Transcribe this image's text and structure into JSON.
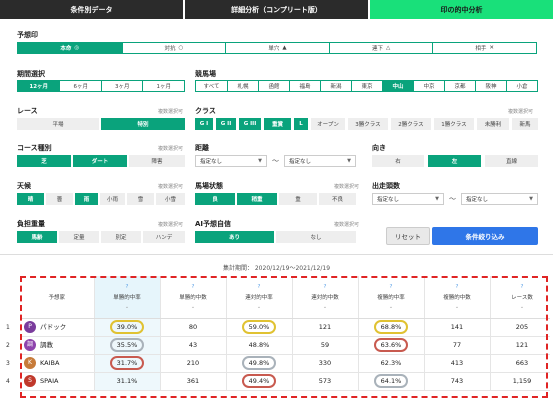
{
  "tabs": [
    "条件別データ",
    "詳細分析（コンプリート版）",
    "印の的中分析"
  ],
  "mark": {
    "label": "予想印",
    "options": [
      {
        "label": "本命",
        "symbol": "◎"
      },
      {
        "label": "対抗",
        "symbol": "○"
      },
      {
        "label": "単穴",
        "symbol": "▲"
      },
      {
        "label": "連下",
        "symbol": "△"
      },
      {
        "label": "相手",
        "symbol": "✕"
      }
    ]
  },
  "period": {
    "label": "期間選択",
    "options": [
      "12ヶ月",
      "6ヶ月",
      "3ヶ月",
      "1ヶ月"
    ]
  },
  "venue": {
    "label": "競馬場",
    "options": [
      "すべて",
      "札幌",
      "函館",
      "福島",
      "新潟",
      "東京",
      "中山",
      "中京",
      "京都",
      "阪神",
      "小倉"
    ]
  },
  "race": {
    "label": "レース",
    "note": "複数選択可",
    "options": [
      "平場",
      "特別"
    ]
  },
  "class": {
    "label": "クラス",
    "note": "複数選択可",
    "options": [
      "G I",
      "G II",
      "G III",
      "重賞",
      "L",
      "オープン",
      "3勝クラス",
      "2勝クラス",
      "1勝クラス",
      "未勝利",
      "新馬"
    ]
  },
  "course": {
    "label": "コース種別",
    "note": "複数選択可",
    "options": [
      "芝",
      "ダート",
      "障害"
    ]
  },
  "distance": {
    "label": "距離",
    "from": "指定なし",
    "to": "指定なし",
    "tilde": "〜"
  },
  "direction": {
    "label": "向き",
    "options": [
      "右",
      "左",
      "直線"
    ]
  },
  "weather": {
    "label": "天候",
    "note": "複数選択可",
    "options": [
      "晴",
      "曇",
      "雨",
      "小雨",
      "雪",
      "小雪"
    ]
  },
  "track": {
    "label": "馬場状態",
    "note": "複数選択可",
    "options": [
      "良",
      "稍重",
      "重",
      "不良"
    ]
  },
  "runners": {
    "label": "出走頭数",
    "from": "指定なし",
    "to": "指定なし",
    "tilde": "〜"
  },
  "weight": {
    "label": "負担重量",
    "note": "複数選択可",
    "options": [
      "馬齢",
      "定量",
      "別定",
      "ハンデ"
    ]
  },
  "ai": {
    "label": "AI予想自信",
    "note": "複数選択可",
    "options": [
      "あり",
      "なし"
    ]
  },
  "actions": {
    "reset": "リセット",
    "submit": "条件絞り込み"
  },
  "summary_period": "集計期間： 2020/12/19〜2021/12/19",
  "table": {
    "headers": [
      "予想家",
      "単勝的中率",
      "単勝的中数",
      "連対的中率",
      "連対的中数",
      "複勝的中率",
      "複勝的中数",
      "レース数"
    ],
    "q": "?",
    "sort_arrow": "⌄",
    "rows": [
      {
        "num": "1",
        "avatar": "P",
        "name": "パドック",
        "c1": "39.0%",
        "c2": "80",
        "c3": "59.0%",
        "c4": "121",
        "c5": "68.8%",
        "c6": "141",
        "c7": "205"
      },
      {
        "num": "2",
        "avatar": "調",
        "name": "調教",
        "c1": "35.5%",
        "c2": "43",
        "c3": "48.8%",
        "c4": "59",
        "c5": "63.6%",
        "c6": "77",
        "c7": "121"
      },
      {
        "num": "3",
        "avatar": "K",
        "name": "KAIBA",
        "c1": "31.7%",
        "c2": "210",
        "c3": "49.8%",
        "c4": "330",
        "c5": "62.3%",
        "c6": "413",
        "c7": "663"
      },
      {
        "num": "4",
        "avatar": "S",
        "name": "SPAIA",
        "c1": "31.1%",
        "c2": "361",
        "c3": "49.4%",
        "c4": "573",
        "c5": "64.1%",
        "c6": "743",
        "c7": "1,159"
      }
    ]
  },
  "colors": {
    "accent": "#0aa37c",
    "tab_active": "#19e07a",
    "submit": "#2f76e8",
    "highlight": "#e02424"
  }
}
